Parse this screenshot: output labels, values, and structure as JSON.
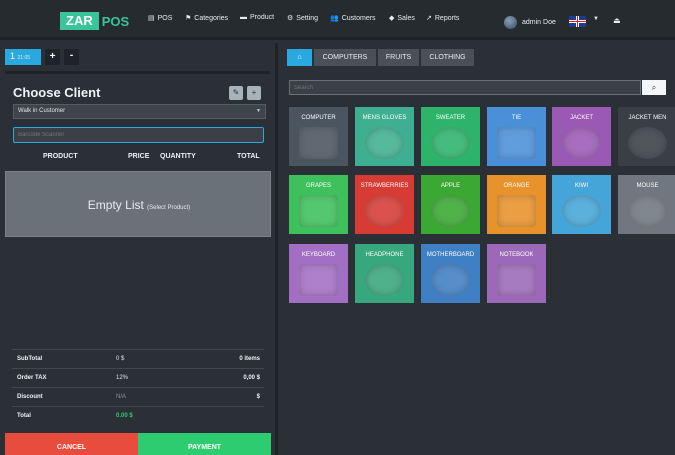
{
  "brand": {
    "zar": "ZAR",
    "pos": "POS"
  },
  "nav": [
    {
      "icon": "▤",
      "label": "POS"
    },
    {
      "icon": "⚑",
      "label": "Categories"
    },
    {
      "icon": "▬",
      "label": "Product"
    },
    {
      "icon": "⚙",
      "label": "Setting"
    },
    {
      "icon": "👥",
      "label": "Customers"
    },
    {
      "icon": "◆",
      "label": "Sales"
    },
    {
      "icon": "↗",
      "label": "Reports"
    }
  ],
  "user": {
    "name": "admin Doe"
  },
  "ticket": {
    "number": "1",
    "time": "21:05"
  },
  "tab_controls": {
    "add": "+",
    "remove": "-"
  },
  "client": {
    "title": "Choose Client",
    "selected": "Walk in Customer",
    "barcode_placeholder": "Barcode Scanner"
  },
  "columns": {
    "product": "PRODUCT",
    "price": "PRICE",
    "quantity": "QUANTITY",
    "total": "TOTAL"
  },
  "empty": {
    "main": "Empty List",
    "sub": "(Select Product)"
  },
  "totals": {
    "subtotal": {
      "label": "SubTotal",
      "mid": "0 $",
      "right": "0 items"
    },
    "tax": {
      "label": "Order TAX",
      "mid": "12%",
      "right": "0,00 $"
    },
    "discount": {
      "label": "Discount",
      "mid": "N/A",
      "right": "$"
    },
    "total": {
      "label": "Total",
      "mid": "0.00 $",
      "right": ""
    }
  },
  "actions": {
    "cancel": "CANCEL",
    "payment": "PAYMENT"
  },
  "categories": [
    "COMPUTERS",
    "FRUITS",
    "CLOTHING"
  ],
  "search": {
    "placeholder": "Search"
  },
  "products": [
    {
      "label": "COMPUTER",
      "color": "#4b5560"
    },
    {
      "label": "MENS GLOVES",
      "color": "#3fb08f"
    },
    {
      "label": "SWEATER",
      "color": "#2db36a"
    },
    {
      "label": "TIE",
      "color": "#4a90d9"
    },
    {
      "label": "JACKET",
      "color": "#9b59b6"
    },
    {
      "label": "JACKET MEN",
      "color": "#3a3f45"
    },
    {
      "label": "GRAPES",
      "color": "#3ec15c"
    },
    {
      "label": "STRAWBERRIES",
      "color": "#d63b34"
    },
    {
      "label": "APPLE",
      "color": "#3aa832"
    },
    {
      "label": "ORANGE",
      "color": "#e8922c"
    },
    {
      "label": "KIWI",
      "color": "#46a5d8"
    },
    {
      "label": "MOUSE",
      "color": "#707780"
    },
    {
      "label": "KEYBOARD",
      "color": "#a36fc4"
    },
    {
      "label": "HEADPHONE",
      "color": "#37a77d"
    },
    {
      "label": "MOTHERBOARD",
      "color": "#3f7fc4"
    },
    {
      "label": "NOTEBOOK",
      "color": "#9b69b8"
    }
  ],
  "colors": {
    "accent": "#2aa8e0",
    "brand": "#3ac49a",
    "cancel": "#e74c3c",
    "payment": "#2ecc71"
  }
}
